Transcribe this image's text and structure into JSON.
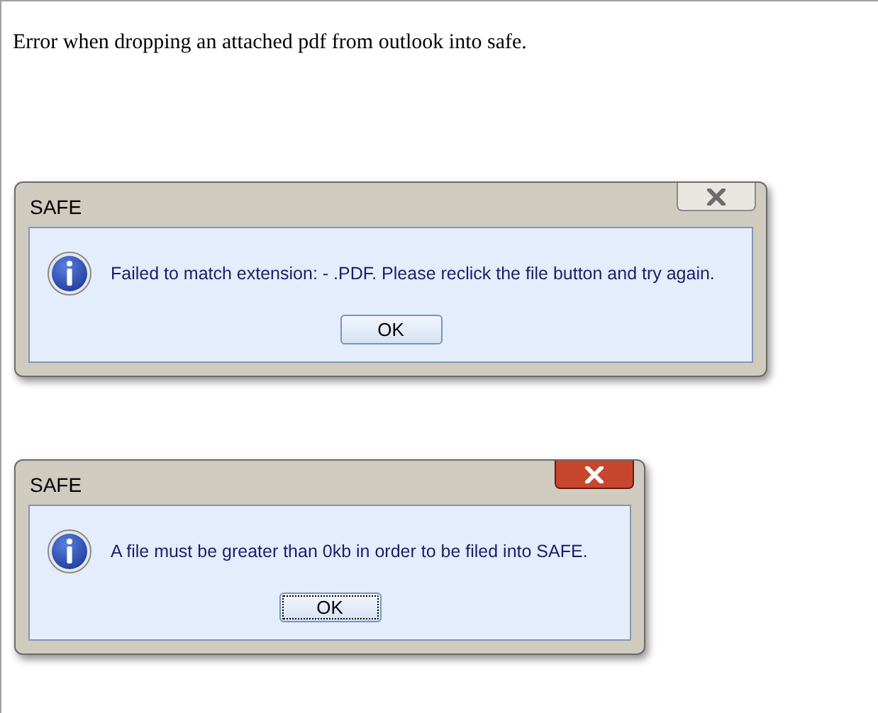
{
  "heading": "Error when dropping an attached pdf from outlook into safe.",
  "dialogs": [
    {
      "title": "SAFE",
      "close_active": false,
      "message": "Failed to match extension:  - .PDF. Please reclick the file button and try again.",
      "ok": {
        "label": "OK",
        "focused": false
      }
    },
    {
      "title": "SAFE",
      "close_active": true,
      "message": "A file must be greater than 0kb in order to be filed into SAFE.",
      "ok": {
        "label": "OK",
        "focused": true
      }
    }
  ]
}
